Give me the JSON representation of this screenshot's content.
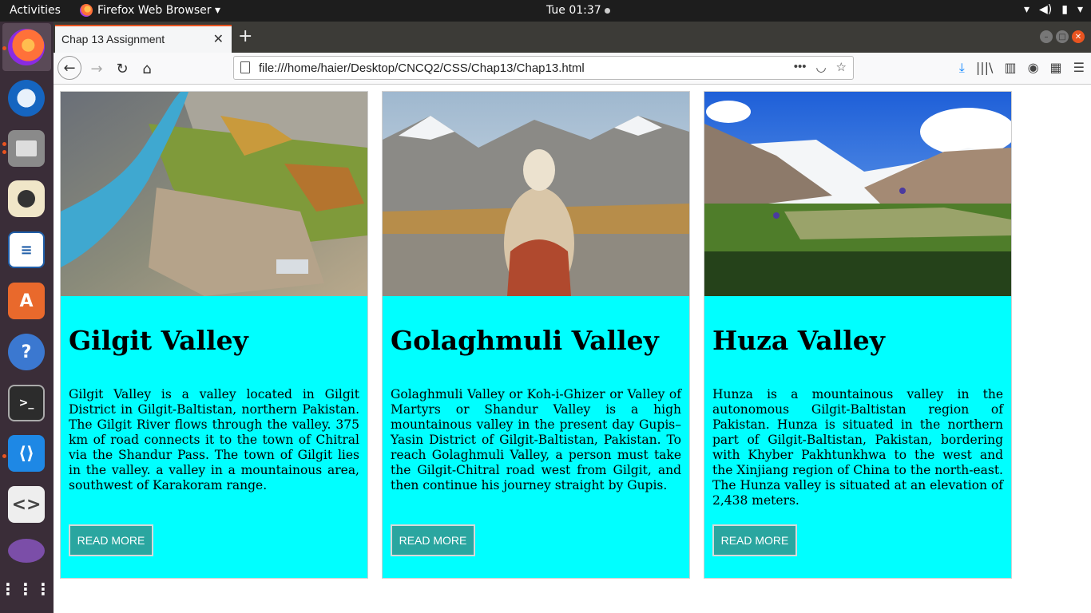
{
  "topbar": {
    "activities": "Activities",
    "app_name": "Firefox Web Browser ▾",
    "clock": "Tue 01:37"
  },
  "browser": {
    "tab_title": "Chap 13 Assignment",
    "url": "file:///home/haier/Desktop/CNCQ2/CSS/Chap13/Chap13.html"
  },
  "cards": [
    {
      "title": "Gilgit Valley",
      "text": "Gilgit Valley is a valley located in Gilgit District in Gilgit-Baltistan, northern Pakistan. The Gilgit River flows through the valley. 375 km of road connects it to the town of Chitral via the Shandur Pass. The town of Gilgit lies in the valley. a valley in a mountainous area, southwest of Karakoram range.",
      "button": "READ MORE"
    },
    {
      "title": "Golaghmuli Valley",
      "text": "Golaghmuli Valley or Koh-i-Ghizer or Valley of Martyrs or Shandur Valley is a high mountainous valley in the present day Gupis–Yasin District of Gilgit-Baltistan, Pakistan. To reach Golaghmuli Valley, a person must take the Gilgit-Chitral road west from Gilgit, and then continue his journey straight by Gupis.",
      "button": "READ MORE"
    },
    {
      "title": "Huza Valley",
      "text": "Hunza is a mountainous valley in the autonomous Gilgit-Baltistan region of Pakistan. Hunza is situated in the northern part of Gilgit-Baltistan, Pakistan, bordering with Khyber Pakhtunkhwa to the west and the Xinjiang region of China to the north-east. The Hunza valley is situated at an elevation of 2,438 meters.",
      "button": "READ MORE"
    }
  ],
  "colors": {
    "card_bg": "#00ffff",
    "button_bg": "#2aa6a0"
  }
}
